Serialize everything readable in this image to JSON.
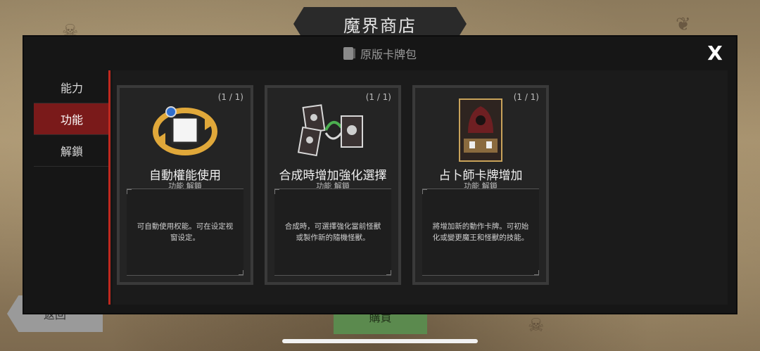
{
  "header": {
    "shop_title": "魔界商店",
    "pack_title": "原版卡牌包",
    "close_label": "X"
  },
  "side_tabs": [
    {
      "label": "能力",
      "active": false
    },
    {
      "label": "功能",
      "active": true
    },
    {
      "label": "解鎖",
      "active": false
    }
  ],
  "cards": [
    {
      "count": "(1 / 1)",
      "name": "自動權能使用",
      "subtitle": "功能 解鎖",
      "description": "可自動使用权能。可在设定视窗设定。",
      "icon": "auto-power-icon"
    },
    {
      "count": "(1 / 1)",
      "name": "合成時增加強化選擇",
      "subtitle": "功能 解鎖",
      "description": "合成時，可選擇強化當前怪獸或製作新的隨機怪獸。",
      "icon": "merge-cards-icon"
    },
    {
      "count": "(1 / 1)",
      "name": "占卜師卡牌增加",
      "subtitle": "功能 解鎖",
      "description": "將增加新的動作卡牌。可初始化或變更魔王和怪獸的技能。",
      "icon": "fortune-teller-icon"
    }
  ],
  "footer": {
    "back_label": "返回",
    "buy_label": "購買"
  },
  "colors": {
    "active_tab": "#7a1a1a",
    "accent_line": "#c0281e",
    "panel_bg": "#161616"
  }
}
